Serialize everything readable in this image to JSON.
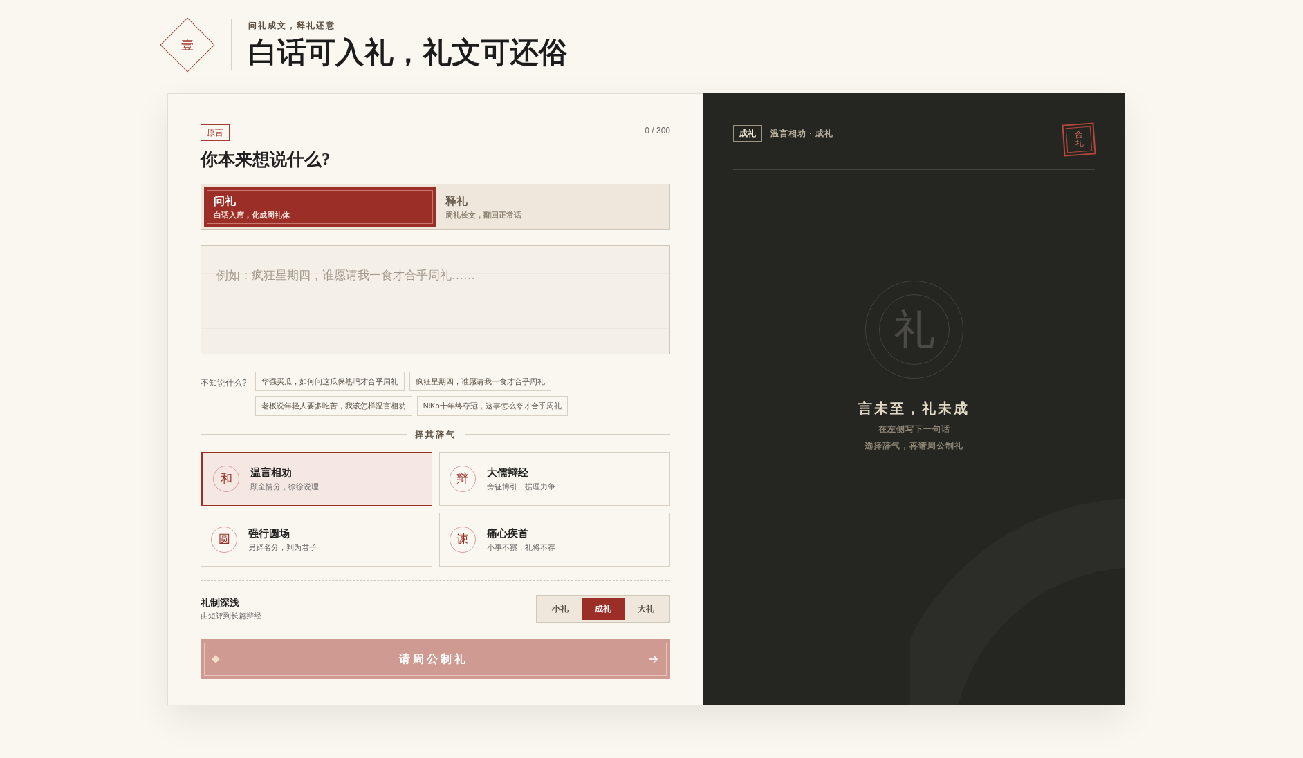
{
  "header": {
    "badge": "壹",
    "kicker": "问礼成文，释礼还意",
    "title": "白话可入礼，礼文可还俗"
  },
  "editor": {
    "tag": "原言",
    "counter": "0 / 300",
    "heading": "你本来想说什么?",
    "modes": [
      {
        "title": "问礼",
        "desc": "白话入席，化成周礼体",
        "selected": true
      },
      {
        "title": "释礼",
        "desc": "周礼长文，翻回正常话",
        "selected": false
      }
    ],
    "input": {
      "placeholder": "例如：疯狂星期四，谁愿请我一食才合乎周礼……"
    },
    "suggest_label": "不知说什么?",
    "suggestions": [
      "华强买瓜，如何问这瓜保熟吗才合乎周礼",
      "疯狂星期四，谁愿请我一食才合乎周礼",
      "老板说年轻人要多吃苦，我该怎样温言相劝",
      "NiKo十年终夺冠，这事怎么夸才合乎周礼"
    ],
    "tone_label": "择其辞气",
    "tones": [
      {
        "glyph": "和",
        "title": "温言相劝",
        "desc": "顾全情分，徐徐说理",
        "selected": true
      },
      {
        "glyph": "辩",
        "title": "大儒辩经",
        "desc": "旁征博引，据理力争",
        "selected": false
      },
      {
        "glyph": "圆",
        "title": "强行圆场",
        "desc": "另辟名分，判为君子",
        "selected": false
      },
      {
        "glyph": "谏",
        "title": "痛心疾首",
        "desc": "小事不察，礼将不存",
        "selected": false
      }
    ],
    "depth": {
      "title": "礼制深浅",
      "desc": "由短评到长篇辩经",
      "options": [
        {
          "label": "小礼",
          "selected": false
        },
        {
          "label": "成礼",
          "selected": true
        },
        {
          "label": "大礼",
          "selected": false
        }
      ]
    },
    "submit": {
      "label": "请周公制礼",
      "disabled": true
    }
  },
  "result": {
    "tag": "成礼",
    "meta": "温言相劝 · 成礼",
    "seal": "合礼",
    "emblem": "礼",
    "title": "言未至，礼未成",
    "lines": [
      "在左侧写下一句话",
      "选择辞气，再请周公制礼"
    ]
  }
}
